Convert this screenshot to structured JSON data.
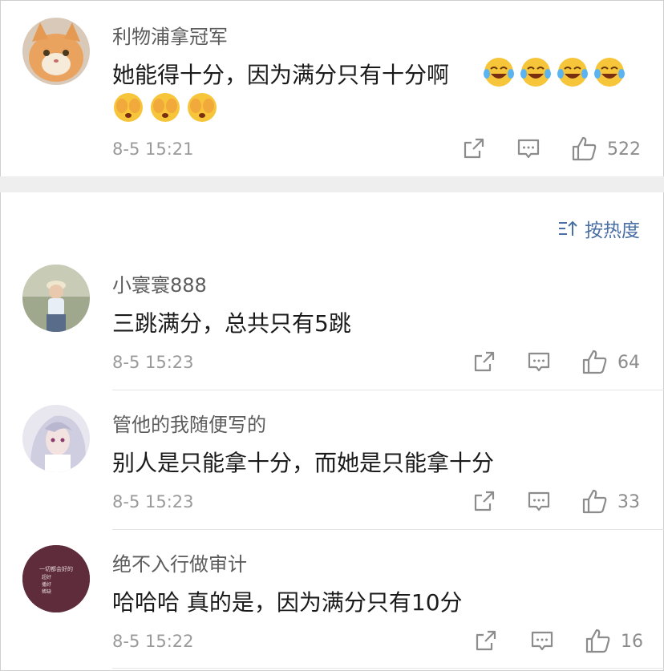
{
  "sort_label": "按热度",
  "comments": [
    {
      "username": "利物浦拿冠军",
      "text": "她能得十分，因为满分只有十分啊",
      "time": "8-5 15:21",
      "likes": "522",
      "emojis": [
        "laugh-cry-emoji",
        "laugh-cry-emoji",
        "laugh-cry-emoji",
        "laugh-cry-emoji",
        "cover-face-emoji",
        "cover-face-emoji",
        "cover-face-emoji"
      ]
    },
    {
      "username": "小寰寰888",
      "text": "三跳满分，总共只有5跳",
      "time": "8-5 15:23",
      "likes": "64"
    },
    {
      "username": "管他的我随便写的",
      "text": "别人是只能拿十分，而她是只能拿十分",
      "time": "8-5 15:23",
      "likes": "33"
    },
    {
      "username": "绝不入行做审计",
      "text": "哈哈哈 真的是，因为满分只有10分",
      "time": "8-5 15:22",
      "likes": "16",
      "avatar_text": [
        "一切都会好的",
        "超好",
        "播好",
        "稀缺"
      ]
    }
  ],
  "colors": {
    "link": "#4a6fa5",
    "muted": "#9a9a9a",
    "gap": "#eeeeee"
  }
}
